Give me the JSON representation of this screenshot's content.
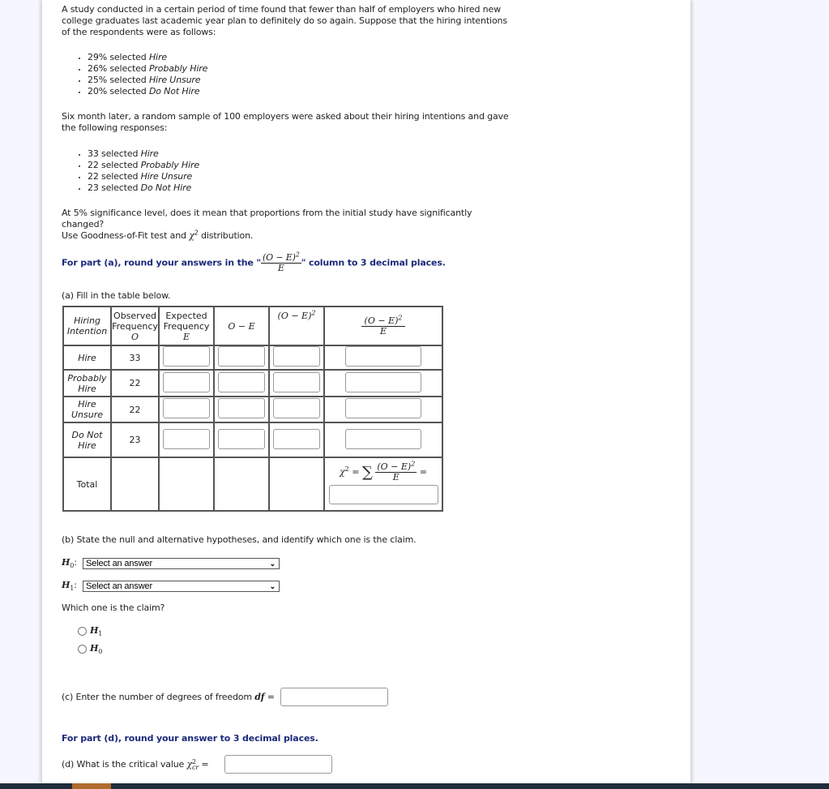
{
  "intro": {
    "paragraph": "A study conducted in a certain period of time found that fewer than half of employers who hired new college graduates last academic year plan to definitely do so again. Suppose that the hiring intentions of the respondents were as follows:",
    "initial_list": [
      {
        "prefix": "29% selected ",
        "category": "Hire"
      },
      {
        "prefix": "26% selected ",
        "category": "Probably Hire"
      },
      {
        "prefix": "25% selected ",
        "category": "Hire Unsure"
      },
      {
        "prefix": "20% selected ",
        "category": "Do Not Hire"
      }
    ],
    "followup": "Six month later, a random sample of 100 employers were asked about their hiring intentions and gave the following responses:",
    "sample_list": [
      {
        "prefix": "33 selected ",
        "category": "Hire"
      },
      {
        "prefix": "22 selected ",
        "category": "Probably Hire"
      },
      {
        "prefix": "22 selected ",
        "category": "Hire Unsure"
      },
      {
        "prefix": "23 selected ",
        "category": "Do Not Hire"
      }
    ],
    "question": "At 5% significance level, does it mean that proportions from the initial study have significantly changed?",
    "method_prefix": "Use Goodness-of-Fit test and ",
    "method_symbol": "χ",
    "method_sup": "2",
    "method_suffix": " distribution."
  },
  "part_a_note": {
    "prefix": "For part (a), round your answers in the \"",
    "suffix": "\" column to 3 decimal places."
  },
  "part_a": {
    "label": "(a) Fill in the table below.",
    "headers": {
      "intention": [
        "Hiring",
        "Intention"
      ],
      "observed": [
        "Observed",
        "Frequency",
        "O"
      ],
      "expected": [
        "Expected",
        "Frequency",
        "E"
      ],
      "o_minus_e": "O − E",
      "sq_num": "(O − E)",
      "sq_sup": "2",
      "ratio_den": "E"
    },
    "rows": [
      {
        "intention": [
          "Hire"
        ],
        "observed": "33",
        "expected": "",
        "o_minus_e": "",
        "squared": "",
        "ratio": ""
      },
      {
        "intention": [
          "Probably",
          "Hire"
        ],
        "observed": "22",
        "expected": "",
        "o_minus_e": "",
        "squared": "",
        "ratio": ""
      },
      {
        "intention": [
          "Hire",
          "Unsure"
        ],
        "observed": "22",
        "expected": "",
        "o_minus_e": "",
        "squared": "",
        "ratio": ""
      },
      {
        "intention": [
          "Do Not",
          "Hire"
        ],
        "observed": "23",
        "expected": "",
        "o_minus_e": "",
        "squared": "",
        "ratio": ""
      }
    ],
    "total_label": "Total",
    "chi_sq_label": "χ",
    "chi_sq_value": ""
  },
  "part_b": {
    "label": "(b) State the null and alternative hypotheses, and identify which one is the claim.",
    "h0_label": "H",
    "h0_sub": "0",
    "h1_label": "H",
    "h1_sub": "1",
    "h0_select": "Select an answer",
    "h1_select": "Select an answer",
    "claim_question": "Which one is the claim?",
    "claim_options": [
      {
        "label": "H",
        "sub": "1",
        "checked": false
      },
      {
        "label": "H",
        "sub": "0",
        "checked": false
      }
    ]
  },
  "part_c": {
    "label": "(c) Enter the number of degrees of freedom ",
    "symbol": "df",
    "value": ""
  },
  "part_d_note": "For part (d), round your answer to 3 decimal places.",
  "part_d": {
    "label": "(d) What is the critical value ",
    "symbol": "χ",
    "sup": "2",
    "sub": "cr",
    "value": ""
  }
}
